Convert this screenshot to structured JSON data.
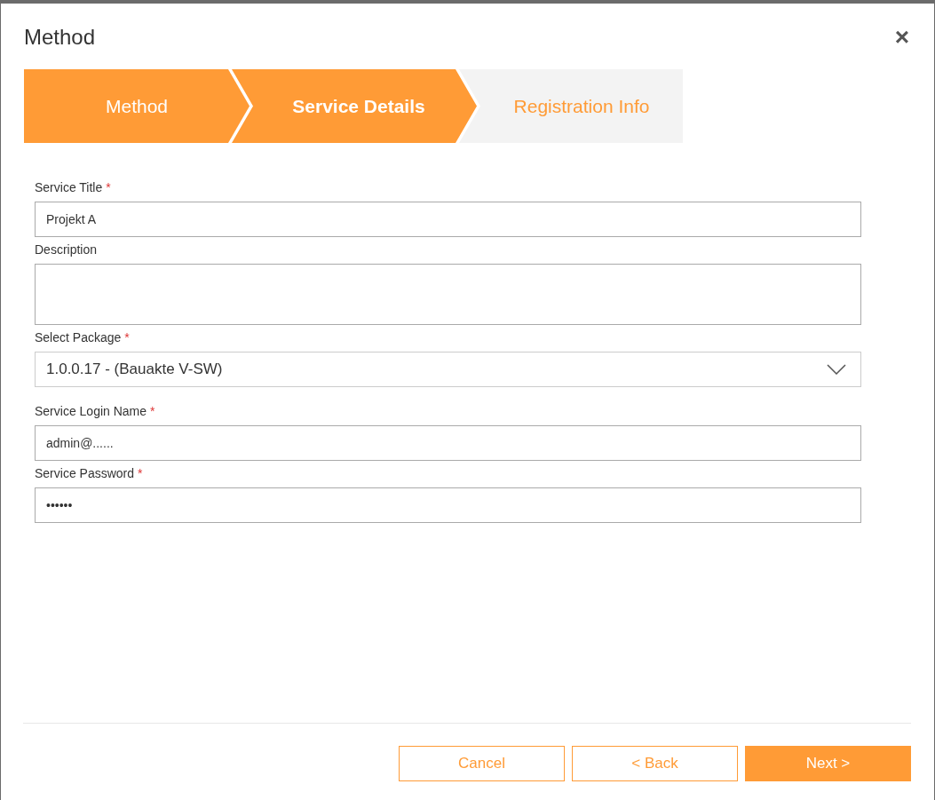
{
  "dialog": {
    "title": "Method",
    "close": "×"
  },
  "steps": [
    {
      "label": "Method",
      "selected": false,
      "reached": true
    },
    {
      "label": "Service Details",
      "selected": true,
      "reached": true
    },
    {
      "label": "Registration Info",
      "selected": false,
      "reached": false
    }
  ],
  "required_mark": "*",
  "fields": [
    {
      "kind": "text",
      "label": "Service Title",
      "required": true,
      "value": "Projekt A"
    },
    {
      "kind": "textarea",
      "label": "Description",
      "required": false
    },
    {
      "kind": "select",
      "label": "Select Package",
      "required": true,
      "value": "1.0.0.17 - (Bauakte V-SW)"
    },
    {
      "kind": "text",
      "label": "Service Login Name",
      "required": true,
      "value": "admin@......"
    },
    {
      "kind": "password",
      "label": "Service Password",
      "required": true,
      "value": "••••••"
    }
  ],
  "buttons": [
    {
      "label": "Cancel",
      "kind": "secondary"
    },
    {
      "label": "< Back",
      "kind": "secondary"
    },
    {
      "label": "Next >",
      "kind": "primary"
    }
  ]
}
